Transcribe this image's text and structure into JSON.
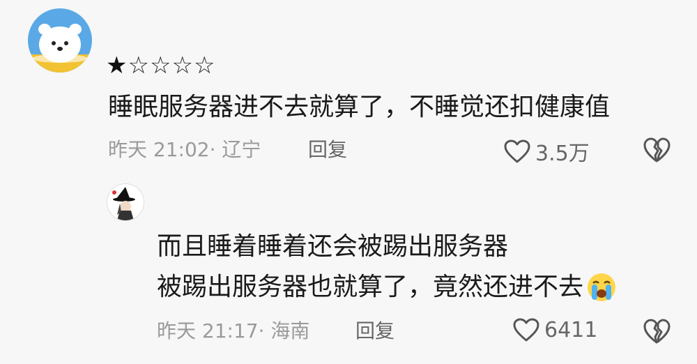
{
  "comment": {
    "rating": {
      "filled": 1,
      "total": 5,
      "filled_glyph": "★",
      "empty_glyph": "☆"
    },
    "text": "睡眠服务器进不去就算了，不睡觉还扣健康值",
    "time_location": "昨天 21:02· 辽宁",
    "reply_label": "回复",
    "like_count": "3.5万",
    "icons": {
      "like": "heart-outline-icon",
      "dislike": "broken-heart-icon",
      "avatar": "white-bear-avatar"
    }
  },
  "reply": {
    "line1": "而且睡着睡着还会被踢出服务器",
    "line2": "被踢出服务器也就算了，竟然还进不去",
    "emoji": "crying-face-emoji",
    "time_location": "昨天 21:17· 海南",
    "reply_label": "回复",
    "like_count": "6411",
    "icons": {
      "like": "heart-outline-icon",
      "dislike": "broken-heart-icon",
      "avatar": "witch-hat-avatar"
    }
  },
  "colors": {
    "background": "#f7f7f7",
    "text": "#1a1a1a",
    "meta": "#9a9a9a",
    "action": "#666666"
  }
}
